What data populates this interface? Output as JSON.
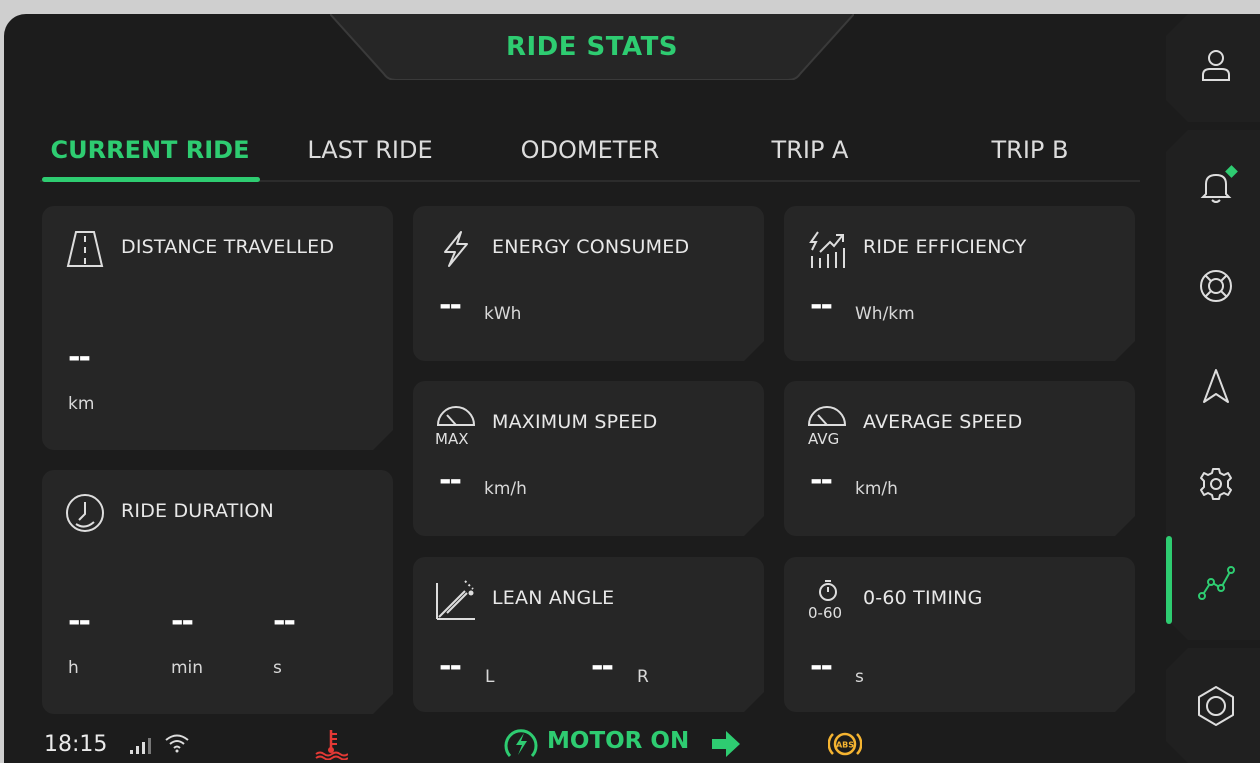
{
  "header": {
    "title": "RIDE STATS"
  },
  "tabs": [
    {
      "label": "CURRENT RIDE",
      "active": true
    },
    {
      "label": "LAST RIDE"
    },
    {
      "label": "ODOMETER"
    },
    {
      "label": "TRIP A"
    },
    {
      "label": "TRIP B"
    }
  ],
  "cards": {
    "distance": {
      "label": "DISTANCE TRAVELLED",
      "value": "--",
      "unit": "km",
      "icon": "road-icon"
    },
    "duration": {
      "label": "RIDE DURATION",
      "hours": "--",
      "hours_unit": "h",
      "minutes": "--",
      "minutes_unit": "min",
      "seconds": "--",
      "seconds_unit": "s",
      "icon": "clock-icon"
    },
    "energy": {
      "label": "ENERGY CONSUMED",
      "value": "--",
      "unit": "kWh",
      "icon": "lightning-icon"
    },
    "efficiency": {
      "label": "RIDE EFFICIENCY",
      "value": "--",
      "unit": "Wh/km",
      "icon": "efficiency-chart-icon"
    },
    "max_speed": {
      "label": "MAXIMUM SPEED",
      "value": "--",
      "unit": "km/h",
      "icon_text": "MAX",
      "icon": "speedometer-icon"
    },
    "avg_speed": {
      "label": "AVERAGE SPEED",
      "value": "--",
      "unit": "km/h",
      "icon_text": "AVG",
      "icon": "speedometer-icon"
    },
    "lean": {
      "label": "LEAN ANGLE",
      "left_value": "--",
      "left_unit": "L",
      "right_value": "--",
      "right_unit": "R",
      "icon": "lean-angle-icon"
    },
    "timing": {
      "label": "0-60 TIMING",
      "value": "--",
      "unit": "s",
      "icon_text": "0-60",
      "icon": "stopwatch-icon"
    }
  },
  "sidebar": {
    "items": [
      {
        "name": "profile",
        "icon": "user-icon"
      },
      {
        "name": "notifications",
        "icon": "bell-icon",
        "badge": true
      },
      {
        "name": "support",
        "icon": "lifebuoy-icon"
      },
      {
        "name": "navigation",
        "icon": "navigation-arrow-icon"
      },
      {
        "name": "settings",
        "icon": "gear-icon"
      },
      {
        "name": "ride-stats",
        "icon": "stats-chart-icon",
        "active": true
      },
      {
        "name": "home",
        "icon": "hexagon-icon"
      }
    ]
  },
  "status": {
    "time": "18:15",
    "motor": "MOTOR ON",
    "icons": [
      "signal-icon",
      "wifi-icon",
      "coolant-temperature-icon",
      "motor-icon",
      "turn-right-arrow-icon",
      "abs-icon"
    ],
    "colors": {
      "accent": "#2ecc71",
      "warning_red": "#e53935",
      "abs_amber": "#f5b431"
    }
  }
}
